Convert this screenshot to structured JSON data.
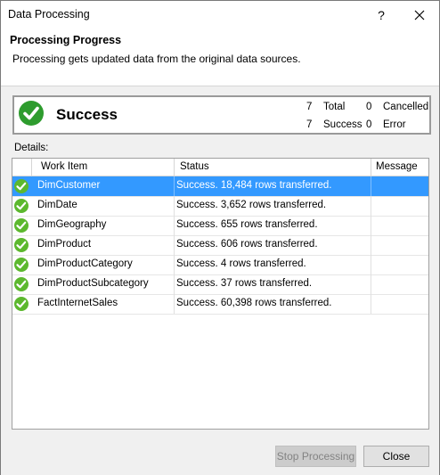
{
  "window": {
    "title": "Data Processing",
    "help_glyph": "?"
  },
  "header": {
    "title": "Processing Progress",
    "subtitle": "Processing gets updated data from the original data sources."
  },
  "summary": {
    "status": "Success",
    "total_count": "7",
    "total_label": "Total",
    "cancelled_count": "0",
    "cancelled_label": "Cancelled",
    "success_count": "7",
    "success_label": "Success",
    "error_count": "0",
    "error_label": "Error"
  },
  "details": {
    "label": "Details:",
    "columns": [
      "Work Item",
      "Status",
      "Message"
    ],
    "rows": [
      {
        "item": "DimCustomer",
        "status": "Success. 18,484 rows transferred.",
        "message": ""
      },
      {
        "item": "DimDate",
        "status": "Success. 3,652 rows transferred.",
        "message": ""
      },
      {
        "item": "DimGeography",
        "status": "Success. 655 rows transferred.",
        "message": ""
      },
      {
        "item": "DimProduct",
        "status": "Success. 606 rows transferred.",
        "message": ""
      },
      {
        "item": "DimProductCategory",
        "status": "Success. 4 rows transferred.",
        "message": ""
      },
      {
        "item": "DimProductSubcategory",
        "status": "Success. 37 rows transferred.",
        "message": ""
      },
      {
        "item": "FactInternetSales",
        "status": "Success. 60,398 rows transferred.",
        "message": ""
      }
    ]
  },
  "buttons": {
    "stop": "Stop Processing",
    "close": "Close"
  },
  "colors": {
    "success_green": "#2e9c2e",
    "row_icon_green": "#5cb82e",
    "selection": "#3399ff"
  }
}
